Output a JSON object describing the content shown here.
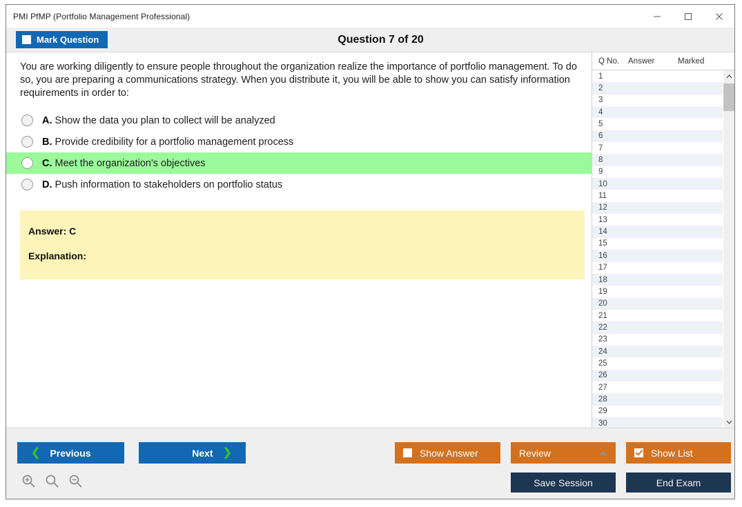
{
  "window": {
    "title": "PMI PfMP (Portfolio Management Professional)",
    "controls": {
      "minimize": "minimize-icon",
      "maximize": "maximize-icon",
      "close": "close-icon"
    }
  },
  "header": {
    "mark_question_label": "Mark Question",
    "mark_question_checked": false,
    "question_counter": "Question 7 of 20"
  },
  "question": {
    "text": "You are working diligently to ensure people throughout the organization realize the importance of portfolio management. To do so, you are preparing a communications strategy. When you distribute it, you will be able to show you can satisfy information requirements in order to:",
    "options": [
      {
        "letter": "A.",
        "text": "Show the data you plan to collect will be analyzed",
        "correct": false,
        "selected": false
      },
      {
        "letter": "B.",
        "text": "Provide credibility for a portfolio management process",
        "correct": false,
        "selected": false
      },
      {
        "letter": "C.",
        "text": "Meet the organization's objectives",
        "correct": true,
        "selected": false
      },
      {
        "letter": "D.",
        "text": "Push information to stakeholders on portfolio status",
        "correct": false,
        "selected": false
      }
    ]
  },
  "answer_panel": {
    "answer_label": "Answer: C",
    "explanation_label": "Explanation:",
    "background": "#fcf4b9"
  },
  "question_list": {
    "columns": [
      "Q No.",
      "Answer",
      "Marked"
    ],
    "rows": [
      {
        "no": "1",
        "answer": "",
        "marked": ""
      },
      {
        "no": "2",
        "answer": "",
        "marked": ""
      },
      {
        "no": "3",
        "answer": "",
        "marked": ""
      },
      {
        "no": "4",
        "answer": "",
        "marked": ""
      },
      {
        "no": "5",
        "answer": "",
        "marked": ""
      },
      {
        "no": "6",
        "answer": "",
        "marked": ""
      },
      {
        "no": "7",
        "answer": "",
        "marked": ""
      },
      {
        "no": "8",
        "answer": "",
        "marked": ""
      },
      {
        "no": "9",
        "answer": "",
        "marked": ""
      },
      {
        "no": "10",
        "answer": "",
        "marked": ""
      },
      {
        "no": "11",
        "answer": "",
        "marked": ""
      },
      {
        "no": "12",
        "answer": "",
        "marked": ""
      },
      {
        "no": "13",
        "answer": "",
        "marked": ""
      },
      {
        "no": "14",
        "answer": "",
        "marked": ""
      },
      {
        "no": "15",
        "answer": "",
        "marked": ""
      },
      {
        "no": "16",
        "answer": "",
        "marked": ""
      },
      {
        "no": "17",
        "answer": "",
        "marked": ""
      },
      {
        "no": "18",
        "answer": "",
        "marked": ""
      },
      {
        "no": "19",
        "answer": "",
        "marked": ""
      },
      {
        "no": "20",
        "answer": "",
        "marked": ""
      },
      {
        "no": "21",
        "answer": "",
        "marked": ""
      },
      {
        "no": "22",
        "answer": "",
        "marked": ""
      },
      {
        "no": "23",
        "answer": "",
        "marked": ""
      },
      {
        "no": "24",
        "answer": "",
        "marked": ""
      },
      {
        "no": "25",
        "answer": "",
        "marked": ""
      },
      {
        "no": "26",
        "answer": "",
        "marked": ""
      },
      {
        "no": "27",
        "answer": "",
        "marked": ""
      },
      {
        "no": "28",
        "answer": "",
        "marked": ""
      },
      {
        "no": "29",
        "answer": "",
        "marked": ""
      },
      {
        "no": "30",
        "answer": "",
        "marked": ""
      }
    ]
  },
  "footer": {
    "previous_label": "Previous",
    "next_label": "Next",
    "show_answer_label": "Show Answer",
    "show_answer_checked": false,
    "review_label": "Review",
    "show_list_label": "Show List",
    "show_list_checked": true,
    "save_session_label": "Save Session",
    "end_exam_label": "End Exam",
    "zoom_icons": [
      "zoom-in-icon",
      "zoom-reset-icon",
      "zoom-out-icon"
    ]
  },
  "colors": {
    "primary_blue": "#1268b3",
    "accent_orange": "#d4711f",
    "dark_navy": "#1d3651",
    "correct_green": "#9bfb9b",
    "answer_yellow": "#fcf4b9",
    "chevron_green": "#2fc22f"
  }
}
